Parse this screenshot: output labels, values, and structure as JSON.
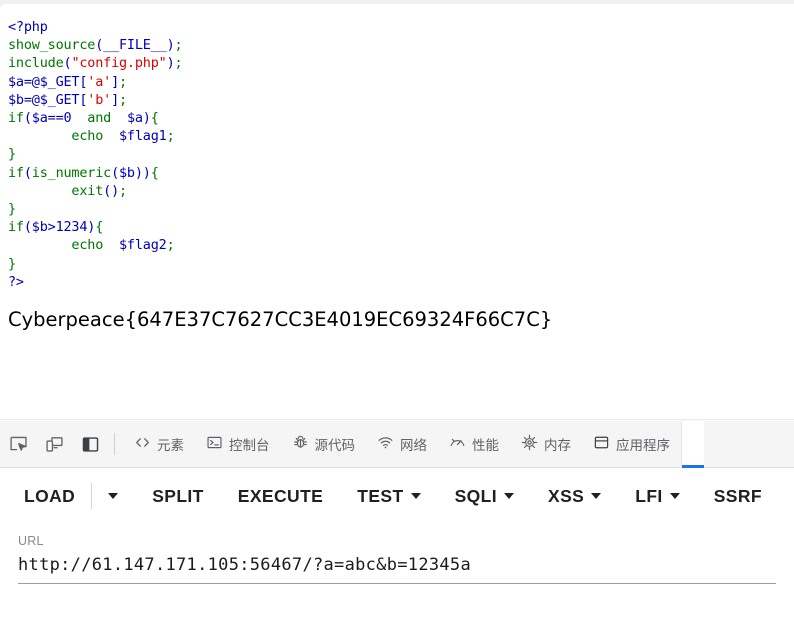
{
  "page": {
    "code_lines": [
      {
        "segments": [
          {
            "t": "<?php",
            "c": "default"
          }
        ]
      },
      {
        "segments": [
          {
            "t": "show_source",
            "c": "keyword"
          },
          {
            "t": "(__FILE__)",
            "c": "default"
          },
          {
            "t": ";",
            "c": "punct"
          }
        ]
      },
      {
        "segments": [
          {
            "t": "include",
            "c": "keyword"
          },
          {
            "t": "(",
            "c": "default"
          },
          {
            "t": "\"config.php\"",
            "c": "string"
          },
          {
            "t": ")",
            "c": "default"
          },
          {
            "t": ";",
            "c": "punct"
          }
        ]
      },
      {
        "segments": [
          {
            "t": "$a=@$_GET",
            "c": "var"
          },
          {
            "t": "[",
            "c": "default"
          },
          {
            "t": "'a'",
            "c": "string"
          },
          {
            "t": "]",
            "c": "default"
          },
          {
            "t": ";",
            "c": "punct"
          }
        ]
      },
      {
        "segments": [
          {
            "t": "$b=@$_GET",
            "c": "var"
          },
          {
            "t": "[",
            "c": "default"
          },
          {
            "t": "'b'",
            "c": "string"
          },
          {
            "t": "]",
            "c": "default"
          },
          {
            "t": ";",
            "c": "punct"
          }
        ]
      },
      {
        "segments": [
          {
            "t": "if",
            "c": "keyword"
          },
          {
            "t": "($a==0",
            "c": "var"
          },
          {
            "t": "  ",
            "c": "default"
          },
          {
            "t": "and",
            "c": "keyword"
          },
          {
            "t": "  ",
            "c": "default"
          },
          {
            "t": "$a)",
            "c": "var"
          },
          {
            "t": "{",
            "c": "punct"
          }
        ]
      },
      {
        "segments": [
          {
            "t": "        ",
            "c": "default"
          },
          {
            "t": "echo",
            "c": "keyword"
          },
          {
            "t": "  ",
            "c": "default"
          },
          {
            "t": "$flag1",
            "c": "var"
          },
          {
            "t": ";",
            "c": "punct"
          }
        ]
      },
      {
        "segments": [
          {
            "t": "}",
            "c": "punct"
          }
        ]
      },
      {
        "segments": [
          {
            "t": "if",
            "c": "keyword"
          },
          {
            "t": "(",
            "c": "default"
          },
          {
            "t": "is_numeric",
            "c": "keyword"
          },
          {
            "t": "($b))",
            "c": "var"
          },
          {
            "t": "{",
            "c": "punct"
          }
        ]
      },
      {
        "segments": [
          {
            "t": "        ",
            "c": "default"
          },
          {
            "t": "exit",
            "c": "keyword"
          },
          {
            "t": "()",
            "c": "default"
          },
          {
            "t": ";",
            "c": "punct"
          }
        ]
      },
      {
        "segments": [
          {
            "t": "}",
            "c": "punct"
          }
        ]
      },
      {
        "segments": [
          {
            "t": "if",
            "c": "keyword"
          },
          {
            "t": "($b>1234)",
            "c": "var"
          },
          {
            "t": "{",
            "c": "punct"
          }
        ]
      },
      {
        "segments": [
          {
            "t": "        ",
            "c": "default"
          },
          {
            "t": "echo",
            "c": "keyword"
          },
          {
            "t": "  ",
            "c": "default"
          },
          {
            "t": "$flag2",
            "c": "var"
          },
          {
            "t": ";",
            "c": "punct"
          }
        ]
      },
      {
        "segments": [
          {
            "t": "}",
            "c": "punct"
          }
        ]
      },
      {
        "segments": [
          {
            "t": "?>",
            "c": "default"
          }
        ]
      }
    ],
    "flag_text": "Cyberpeace{647E37C7627CC3E4019EC69324F66C7C}"
  },
  "devtools": {
    "icon_buttons": [
      {
        "name": "inspect-element-icon",
        "title": "inspect"
      },
      {
        "name": "device-toolbar-icon",
        "title": "device toolbar"
      },
      {
        "name": "dock-panel-icon",
        "title": "dock"
      }
    ],
    "tabs": [
      {
        "label": "元素",
        "icon": "code-brackets-icon",
        "active": false
      },
      {
        "label": "控制台",
        "icon": "console-terminal-icon",
        "active": false
      },
      {
        "label": "源代码",
        "icon": "bug-icon",
        "active": false
      },
      {
        "label": "网络",
        "icon": "wifi-icon",
        "active": false
      },
      {
        "label": "性能",
        "icon": "gauge-icon",
        "active": false
      },
      {
        "label": "内存",
        "icon": "chip-icon",
        "active": false
      },
      {
        "label": "应用程序",
        "icon": "database-icon",
        "active": false
      },
      {
        "label": "",
        "icon": "",
        "active": true
      }
    ],
    "accent_color": "#1a73e8"
  },
  "hackbar": {
    "buttons": [
      {
        "label": "LOAD",
        "caret": false,
        "separator_after": true
      },
      {
        "label": "SPLIT",
        "caret": false,
        "separator_after": false
      },
      {
        "label": "EXECUTE",
        "caret": false,
        "separator_after": false
      },
      {
        "label": "TEST",
        "caret": true,
        "separator_after": false
      },
      {
        "label": "SQLI",
        "caret": true,
        "separator_after": false
      },
      {
        "label": "XSS",
        "caret": true,
        "separator_after": false
      },
      {
        "label": "LFI",
        "caret": true,
        "separator_after": false
      },
      {
        "label": "SSRF",
        "caret": false,
        "separator_after": false
      }
    ],
    "load_caret": "▾",
    "url_label": "URL",
    "url_value": "http://61.147.171.105:56467/?a=abc&b=12345a",
    "url_placeholder": "URL"
  }
}
